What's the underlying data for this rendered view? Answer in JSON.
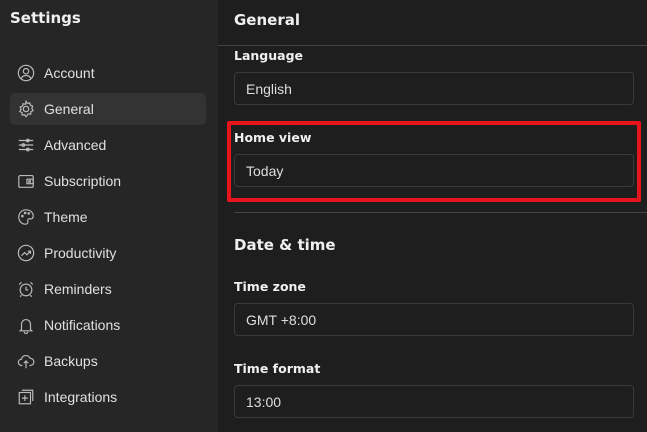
{
  "sidebar": {
    "title": "Settings",
    "items": [
      {
        "label": "Account",
        "icon": "account-icon"
      },
      {
        "label": "General",
        "icon": "gear-icon",
        "selected": true
      },
      {
        "label": "Advanced",
        "icon": "sliders-icon"
      },
      {
        "label": "Subscription",
        "icon": "wallet-icon"
      },
      {
        "label": "Theme",
        "icon": "palette-icon"
      },
      {
        "label": "Productivity",
        "icon": "trend-icon"
      },
      {
        "label": "Reminders",
        "icon": "alarm-clock-icon"
      },
      {
        "label": "Notifications",
        "icon": "bell-icon"
      },
      {
        "label": "Backups",
        "icon": "cloud-upload-icon"
      },
      {
        "label": "Integrations",
        "icon": "plus-square-icon"
      }
    ]
  },
  "main": {
    "title": "General",
    "language": {
      "label": "Language",
      "value": "English"
    },
    "home_view": {
      "label": "Home view",
      "value": "Today"
    },
    "date_time": {
      "title": "Date & time",
      "time_zone": {
        "label": "Time zone",
        "value": "GMT +8:00"
      },
      "time_format": {
        "label": "Time format",
        "value": "13:00"
      }
    }
  },
  "colors": {
    "highlight": "#e8141c",
    "sidebar_bg": "#262626",
    "main_bg": "#1e1e1e"
  }
}
